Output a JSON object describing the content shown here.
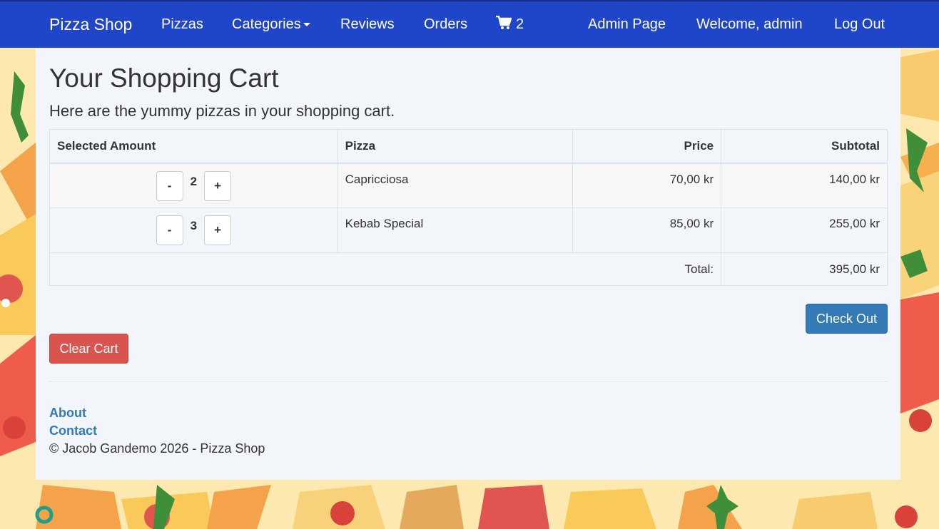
{
  "navbar": {
    "brand": "Pizza Shop",
    "pizzas": "Pizzas",
    "categories": "Categories",
    "reviews": "Reviews",
    "orders": "Orders",
    "cart_count": "2",
    "admin_page": "Admin Page",
    "welcome": "Welcome, admin",
    "logout": "Log Out"
  },
  "page": {
    "title": "Your Shopping Cart",
    "subtitle": "Here are the yummy pizzas in your shopping cart."
  },
  "table": {
    "headers": {
      "amount": "Selected Amount",
      "pizza": "Pizza",
      "price": "Price",
      "subtotal": "Subtotal"
    },
    "rows": [
      {
        "minus": "-",
        "qty": "2",
        "plus": "+",
        "pizza": "Capricciosa",
        "price": "70,00 kr",
        "subtotal": "140,00 kr"
      },
      {
        "minus": "-",
        "qty": "3",
        "plus": "+",
        "pizza": "Kebab Special",
        "price": "85,00 kr",
        "subtotal": "255,00 kr"
      }
    ],
    "total_label": "Total:",
    "total_value": "395,00 kr"
  },
  "actions": {
    "checkout": "Check Out",
    "clear": "Clear Cart"
  },
  "footer": {
    "about": "About",
    "contact": "Contact",
    "copyright": "© Jacob Gandemo 2026 - Pizza Shop"
  },
  "colors": {
    "navbar": "#1f45c9",
    "primary": "#337ab7",
    "danger": "#d9534f",
    "background": "#fde8b0"
  }
}
